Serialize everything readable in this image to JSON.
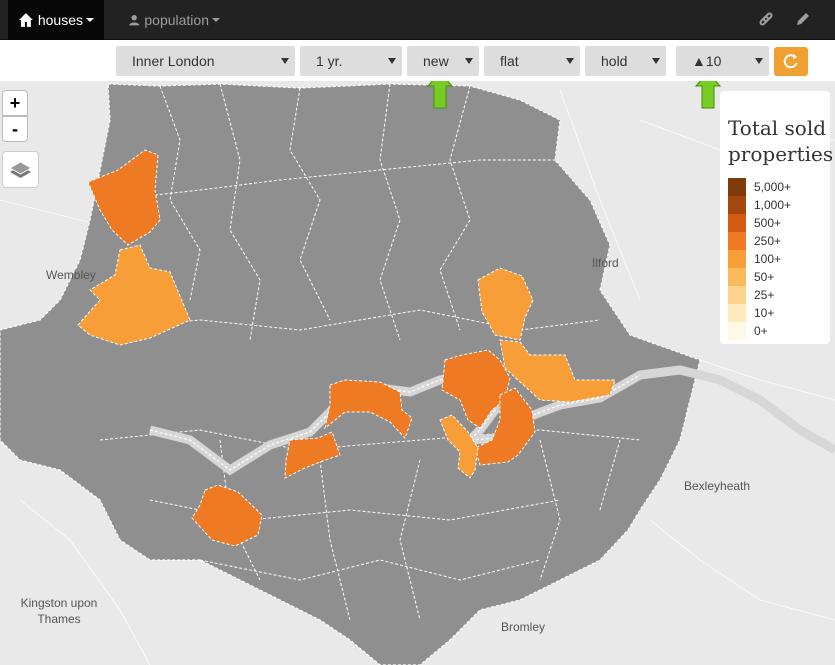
{
  "navbar": {
    "tabs": [
      {
        "label": "houses",
        "icon": "home-icon",
        "active": true
      },
      {
        "label": "population",
        "icon": "user-icon",
        "active": false
      }
    ],
    "right_icons": [
      "link-icon",
      "pencil-icon"
    ]
  },
  "filters": {
    "area": "Inner London",
    "period": "1 yr.",
    "age": "new",
    "type": "flat",
    "tenure": "hold",
    "threshold": "▲10"
  },
  "map": {
    "zoom_in": "+",
    "zoom_out": "-",
    "places": {
      "wembley": "Wembley",
      "ilford": "Ilford",
      "bexleyheath": "Bexleyheath",
      "kingston": "Kingston upon Thames",
      "bromley": "Bromley"
    },
    "colors": {
      "district": "#8f8f8f",
      "boundary": "#ffffff",
      "thames": "#d6d6d6",
      "background": "#e9e9e9"
    }
  },
  "legend": {
    "title": "Total sold properties",
    "items": [
      {
        "label": "5,000+",
        "color": "#7f3b0a"
      },
      {
        "label": "1,000+",
        "color": "#a5480f"
      },
      {
        "label": "500+",
        "color": "#d55a12"
      },
      {
        "label": "250+",
        "color": "#ee7a23"
      },
      {
        "label": "100+",
        "color": "#f89e38"
      },
      {
        "label": "50+",
        "color": "#fbbb5b"
      },
      {
        "label": "25+",
        "color": "#fdd48c"
      },
      {
        "label": "10+",
        "color": "#feeaba"
      },
      {
        "label": "0+",
        "color": "#fff8e4"
      }
    ]
  },
  "accent_color": "#f0a030",
  "navbar_color": "#222222"
}
